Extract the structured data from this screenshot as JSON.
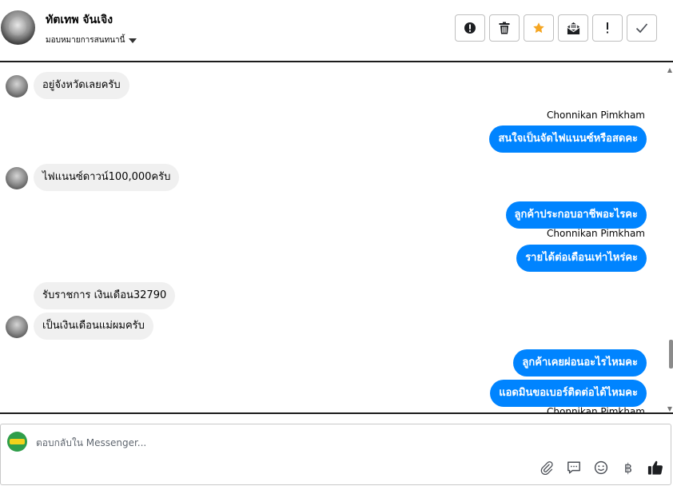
{
  "header": {
    "name": "ทัตเทพ จันเจิง",
    "subtitle": "มอบหมายการสนทนานี้",
    "actions": [
      {
        "id": "alert",
        "icon": "exclamation-circle-icon"
      },
      {
        "id": "delete",
        "icon": "trash-icon"
      },
      {
        "id": "star",
        "icon": "star-icon",
        "color": "#f5a623"
      },
      {
        "id": "mail",
        "icon": "envelope-open-icon"
      },
      {
        "id": "important",
        "icon": "exclamation-icon"
      },
      {
        "id": "done",
        "icon": "checkmark-icon"
      }
    ]
  },
  "messages": [
    {
      "direction": "in",
      "text": "อยู่จังหวัดเลยครับ",
      "avatar": true
    },
    {
      "direction": "out",
      "sender": "Chonnikan Pimkham",
      "text": "สนใจเป็นจัดไฟแนนซ์หรือสดคะ"
    },
    {
      "direction": "in",
      "text": "ไฟแนนซ์ดาวน์100,000ครับ",
      "avatar": true
    },
    {
      "direction": "out",
      "text": "ลูกค้าประกอบอาชีพอะไรคะ"
    },
    {
      "direction": "out",
      "sender": "Chonnikan Pimkham",
      "text": "รายได้ต่อเดือนเท่าไหร่คะ"
    },
    {
      "direction": "in",
      "text": "รับราชการ เงินเดือน32790",
      "avatar": false
    },
    {
      "direction": "in",
      "text": "เป็นเงินเดือนแม่ผมครับ",
      "avatar": true
    },
    {
      "direction": "out",
      "text": "ลูกค้าเคยผ่อนอะไรไหมคะ"
    },
    {
      "direction": "out",
      "text": "แอดมินขอเบอร์ติดต่อได้ไหมคะ"
    },
    {
      "direction": "out-sender-only",
      "sender": "Chonnikan Pimkham"
    }
  ],
  "composer": {
    "placeholder": "ตอบกลับใน Messenger...",
    "tools": [
      "paperclip-icon",
      "speech-bubble-icon",
      "smiley-icon",
      "baht-icon",
      "thumbs-up-icon"
    ],
    "baht_symbol": "฿"
  },
  "colors": {
    "accent": "#0084ff",
    "incoming_bubble": "#f0f0f0",
    "star": "#f5a623"
  }
}
